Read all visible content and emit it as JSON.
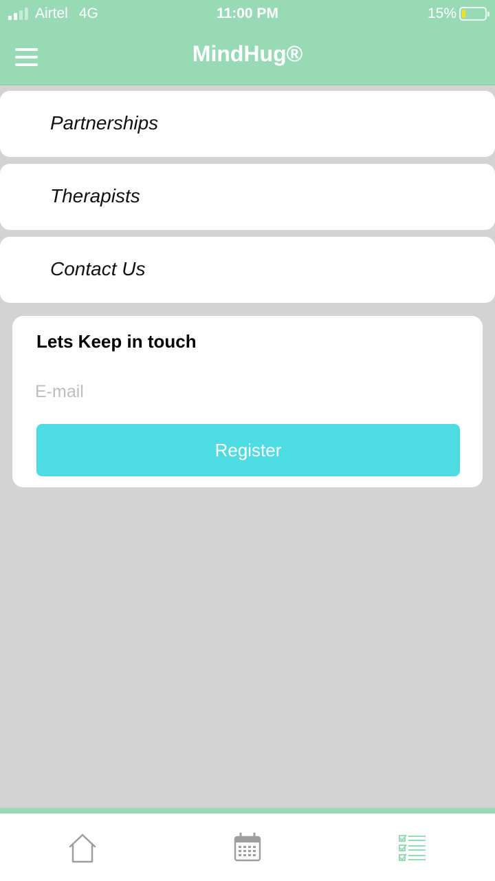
{
  "status_bar": {
    "carrier": "Airtel",
    "network": "4G",
    "time": "11:00 PM",
    "battery": "15%",
    "battery_level": 0.15
  },
  "app_bar": {
    "title": "MindHug®",
    "menu_icon": "hamburger-menu-icon"
  },
  "menu": {
    "items": [
      {
        "label": "Partnerships"
      },
      {
        "label": "Therapists"
      },
      {
        "label": "Contact Us"
      }
    ]
  },
  "newsletter": {
    "heading": "Lets Keep in touch",
    "email_placeholder": "E-mail",
    "email_value": "",
    "button_label": "Register"
  },
  "tab_bar": {
    "tabs": [
      {
        "icon": "home-icon",
        "active": false
      },
      {
        "icon": "calendar-icon",
        "active": false
      },
      {
        "icon": "checklist-icon",
        "active": true
      }
    ]
  },
  "colors": {
    "header": "#99dab6",
    "background": "#d3d3d3",
    "button": "#4fdbe2",
    "icon_inactive": "#9e9e9e",
    "icon_active": "#99dab6"
  }
}
